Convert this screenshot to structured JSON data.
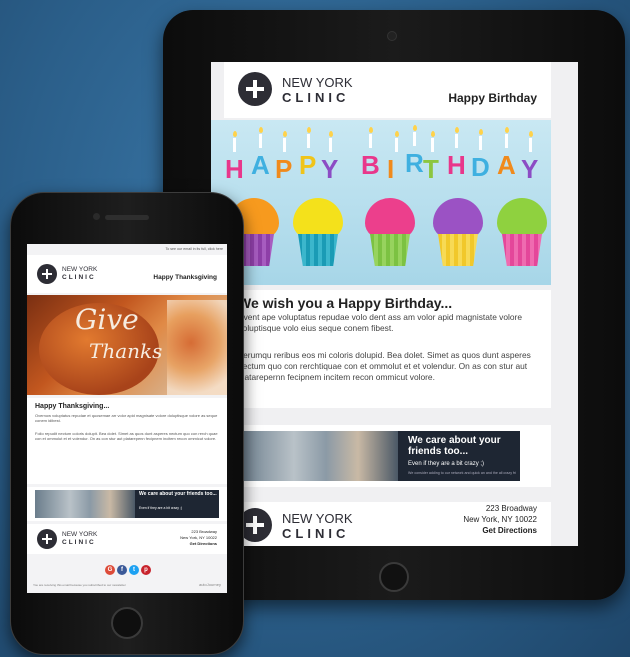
{
  "tablet": {
    "logo_line1": "NEW YORK",
    "logo_line2": "CLINIC",
    "header_title": "Happy Birthday",
    "hero_letters": [
      "H",
      "A",
      "P",
      "P",
      "Y",
      "B",
      "I",
      "R",
      "T",
      "H",
      "D",
      "A",
      "Y"
    ],
    "message_heading": "We wish you a Happy Birthday...",
    "message_para1": "Event ape voluptatus repudae volo dent ass am volor apid magnistate volore doluptisque volo eius seque conem fibest.",
    "message_para2": "Ferumqu reribus eos mi coloris dolupid. Bea dolet. Simet as quos dunt asperes nectum quo con rerchtiquae con et ommolut et et volendur. On as con stur aut platarepernn fecipnem incitem recon ommicut volore.",
    "promo_heading": "We care about your friends too...",
    "promo_sub": "Even if they are a bit crazy ;)",
    "promo_small": "We consider adding to our network and quick an and the all crazy friends",
    "footer_address1": "223 Broadway",
    "footer_address2": "New York, NY 10022",
    "footer_directions": "Get Directions"
  },
  "phone": {
    "top_link": "To see our email in its full, click here",
    "logo_line1": "NEW YORK",
    "logo_line2": "CLINIC",
    "header_title": "Happy Thanksgiving",
    "hero_text1": "Give",
    "hero_text2": "Thanks",
    "message_heading": "Happy Thanksgiving...",
    "message_para1": "Overnow voluptatus repudae et quosemae arr volor apid magnisate volore doluptisque volore as seque conem idibest.",
    "message_para2": "Folio repudit nectum coloris dolupit. Bea dolet. Simet as quos dunt asperes nectum quo con rerch quae con et ommolut et et volendur. On as con stur aut platarepenn fecipnem incitem recon ommicut volore.",
    "promo_heading": "We care about your friends too...",
    "promo_sub": "Even if they are a bit crazy ;)",
    "footer_address1": "223 Broadway",
    "footer_address2": "New York, NY 10022",
    "footer_directions": "Get Directions",
    "social": [
      "G",
      "f",
      "t",
      "p"
    ],
    "bottom_note": "You are receiving this email because you subscribed to our newsletter",
    "brand": "autoJourney"
  }
}
